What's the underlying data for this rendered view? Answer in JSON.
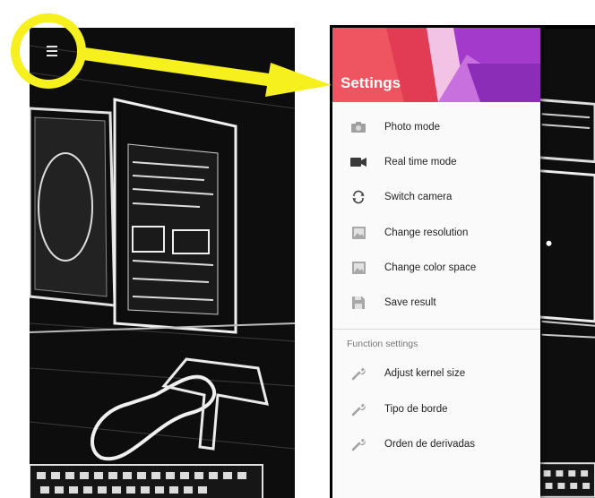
{
  "drawer": {
    "title": "Settings",
    "items": [
      {
        "label": "Photo mode",
        "icon": "camera-icon"
      },
      {
        "label": "Real time mode",
        "icon": "video-camera-icon"
      },
      {
        "label": "Switch camera",
        "icon": "switch-camera-icon"
      },
      {
        "label": "Change resolution",
        "icon": "image-icon"
      },
      {
        "label": "Change color space",
        "icon": "image-icon"
      },
      {
        "label": "Save result",
        "icon": "save-icon"
      }
    ],
    "section_label": "Function settings",
    "function_items": [
      {
        "label": "Adjust kernel size",
        "icon": "wrench-icon"
      },
      {
        "label": "Tipo de borde",
        "icon": "wrench-icon"
      },
      {
        "label": "Orden de derivadas",
        "icon": "wrench-icon"
      }
    ]
  },
  "colors": {
    "annotation": "#f5f01e",
    "header_red": "#e8404c",
    "header_purple": "#9b2fc4",
    "icon_gray": "#9e9e9e"
  }
}
